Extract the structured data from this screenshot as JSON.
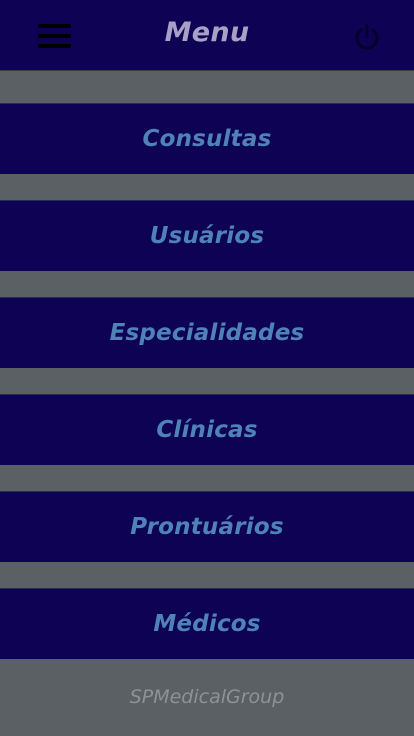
{
  "header": {
    "title": "Menu",
    "menu_icon": "hamburger-icon",
    "power_icon": "power-icon"
  },
  "menu": {
    "items": [
      {
        "label": "Consultas"
      },
      {
        "label": "Usuários"
      },
      {
        "label": "Especialidades"
      },
      {
        "label": "Clínicas"
      },
      {
        "label": "Prontuários"
      },
      {
        "label": "Médicos"
      }
    ]
  },
  "footer": {
    "brand": "SPMedicalGroup"
  },
  "colors": {
    "bar_background": "#0e0254",
    "page_background": "#5b6064",
    "title_text": "#a9a0c6",
    "menu_text": "#4f83b7",
    "footer_text": "#8e9296"
  }
}
